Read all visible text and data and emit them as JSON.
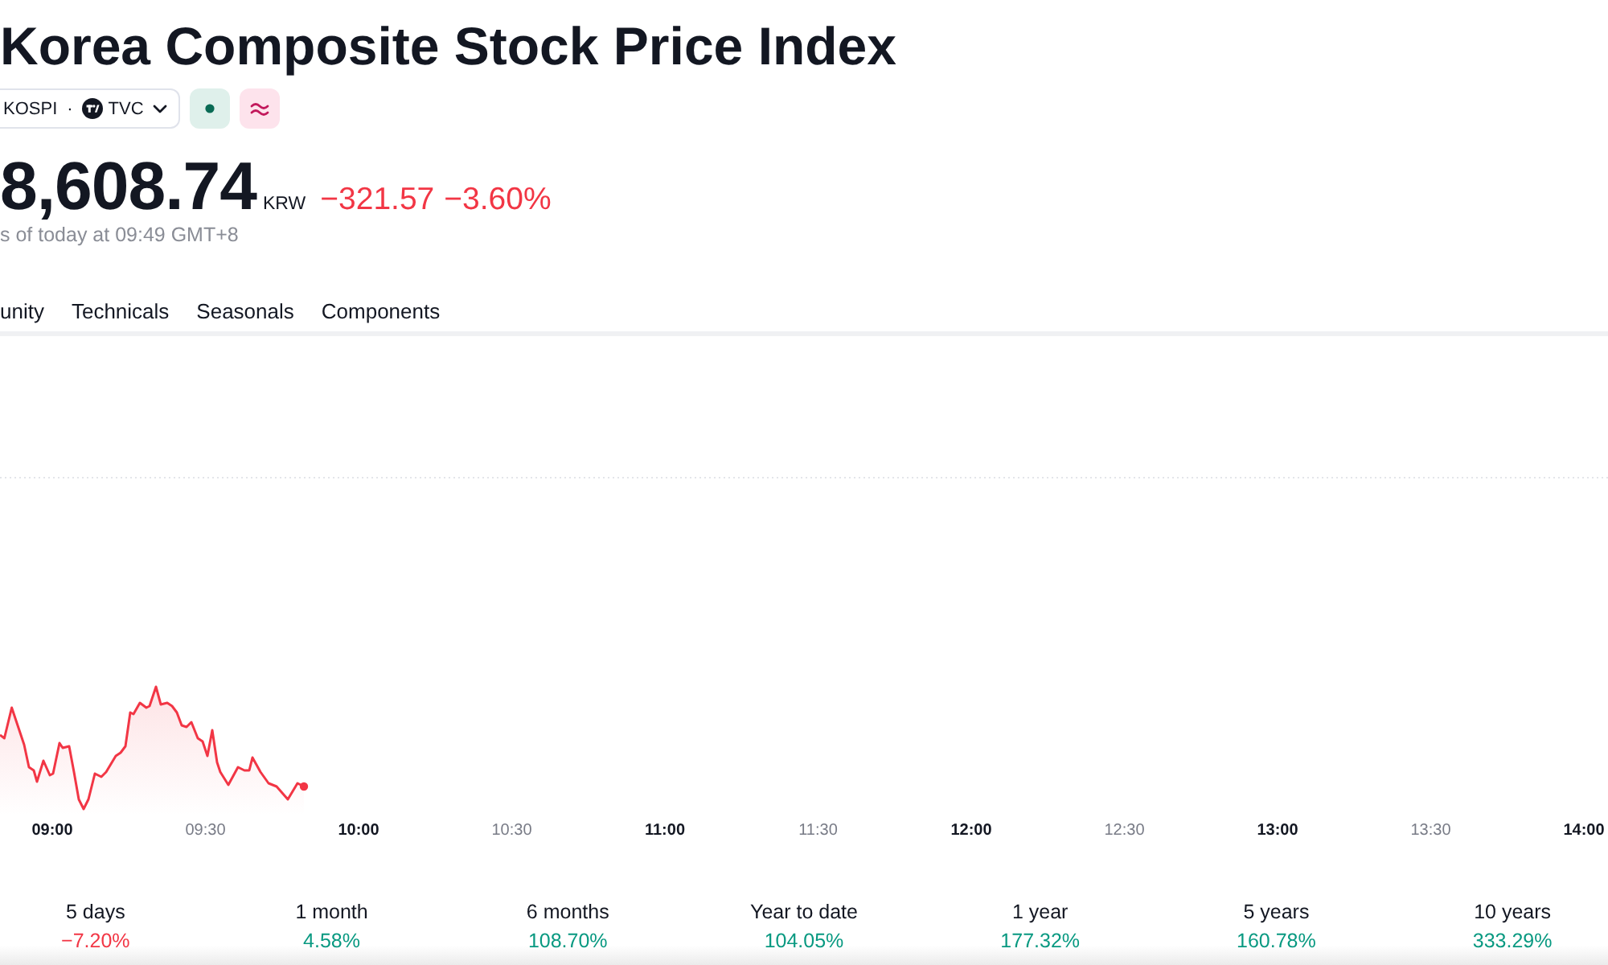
{
  "header": {
    "title": "Korea Composite Stock Price Index",
    "symbol_chip": {
      "ticker": "KOSPI",
      "separator": "·",
      "exchange": "TVC"
    }
  },
  "quote": {
    "price": "8,608.74",
    "currency": "KRW",
    "change": "−321.57",
    "change_percent": "−3.60%",
    "negative": true,
    "as_of": "s of today at 09:49 GMT+8"
  },
  "tabs": [
    {
      "label": "unity",
      "selected": false
    },
    {
      "label": "Technicals",
      "selected": false
    },
    {
      "label": "Seasonals",
      "selected": false
    },
    {
      "label": "Components",
      "selected": false
    }
  ],
  "chart": {
    "negative": true,
    "time_labels": [
      {
        "label": "09:00",
        "major": true
      },
      {
        "label": "09:30",
        "major": false
      },
      {
        "label": "10:00",
        "major": true
      },
      {
        "label": "10:30",
        "major": false
      },
      {
        "label": "11:00",
        "major": true
      },
      {
        "label": "11:30",
        "major": false
      },
      {
        "label": "12:00",
        "major": true
      },
      {
        "label": "12:30",
        "major": false
      },
      {
        "label": "13:00",
        "major": true
      },
      {
        "label": "13:30",
        "major": false
      },
      {
        "label": "14:00",
        "major": true
      }
    ]
  },
  "performance": [
    {
      "period": "5 days",
      "change": "−7.20%",
      "negative": true
    },
    {
      "period": "1 month",
      "change": "4.58%",
      "negative": false
    },
    {
      "period": "6 months",
      "change": "108.70%",
      "negative": false
    },
    {
      "period": "Year to date",
      "change": "104.05%",
      "negative": false
    },
    {
      "period": "1 year",
      "change": "177.32%",
      "negative": false
    },
    {
      "period": "5 years",
      "change": "160.78%",
      "negative": false
    },
    {
      "period": "10 years",
      "change": "333.29%",
      "negative": false
    }
  ]
}
